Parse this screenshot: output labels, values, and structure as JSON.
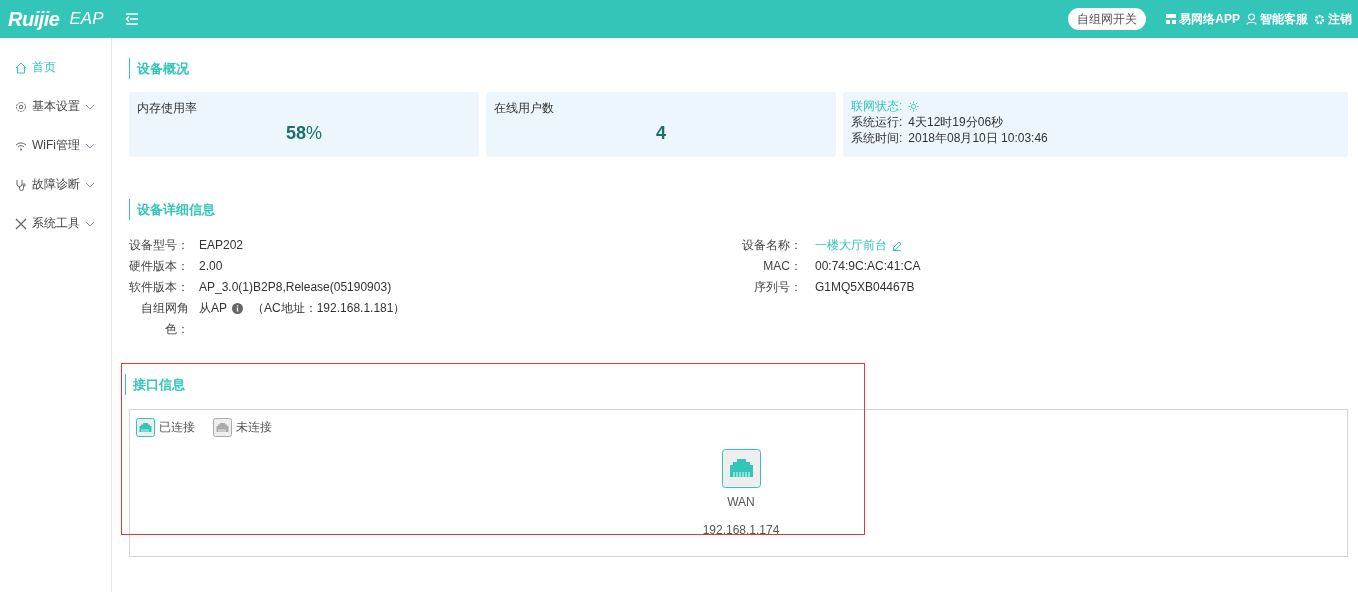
{
  "header": {
    "logo": "Ruijie",
    "product": "EAP",
    "toggle_button": "自组网开关",
    "links": [
      {
        "kind": "qr",
        "label": "易网络APP"
      },
      {
        "kind": "user",
        "label": "智能客服"
      },
      {
        "kind": "power",
        "label": "注销"
      }
    ]
  },
  "sidebar": {
    "items": [
      {
        "kind": "home",
        "label": "首页",
        "selected": true,
        "expandable": false
      },
      {
        "kind": "settings",
        "label": "基本设置",
        "selected": false,
        "expandable": true
      },
      {
        "kind": "wifi",
        "label": "WiFi管理",
        "selected": false,
        "expandable": true
      },
      {
        "kind": "diagnosis",
        "label": "故障诊断",
        "selected": false,
        "expandable": true
      },
      {
        "kind": "tools",
        "label": "系统工具",
        "selected": false,
        "expandable": true
      }
    ]
  },
  "overview": {
    "title": "设备概况",
    "cards": [
      {
        "kind": "metric",
        "label": "内存使用率",
        "value": "58",
        "unit": "%"
      },
      {
        "kind": "metric",
        "label": "在线用户数",
        "value": "4"
      },
      {
        "kind": "status",
        "lines": [
          {
            "label": "联网状态:",
            "icon": true
          },
          {
            "label": "系统运行:",
            "value": "4天12时19分06秒"
          },
          {
            "label": "系统时间:",
            "value": "2018年08月10日 10:03:46"
          }
        ]
      }
    ]
  },
  "details": {
    "title": "设备详细信息",
    "left": [
      {
        "label": "设备型号：",
        "value": "EAP202"
      },
      {
        "label": "硬件版本：",
        "value": "2.00"
      },
      {
        "label": "软件版本：",
        "value": "AP_3.0(1)B2P8,Release(05190903)"
      },
      {
        "label": "自组网角色：",
        "value": "从AP",
        "info": true,
        "note": "（AC地址：192.168.1.181）"
      }
    ],
    "right": [
      {
        "label": "设备名称：",
        "value": "一楼大厅前台",
        "editable": true
      },
      {
        "label": "MAC：",
        "value": "00:74:9C:AC:41:CA"
      },
      {
        "label": "序列号：",
        "value": "G1MQ5XB04467B"
      }
    ]
  },
  "interfaces": {
    "title": "接口信息",
    "legend": [
      {
        "label": "已连接",
        "connected": true
      },
      {
        "label": "未连接",
        "connected": false
      }
    ],
    "ports": [
      {
        "name": "WAN",
        "ip": "192.168.1.174",
        "connected": true
      }
    ]
  }
}
